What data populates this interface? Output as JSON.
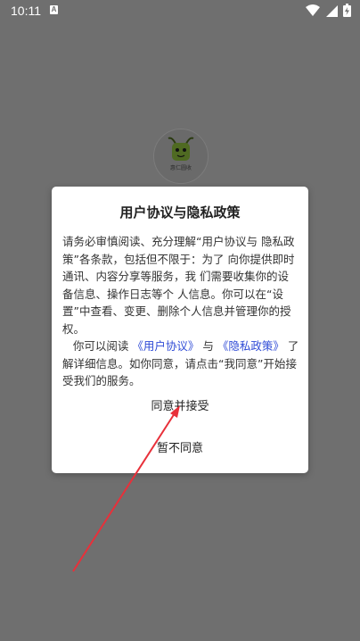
{
  "status_bar": {
    "time": "10:11",
    "notification_icon": "A"
  },
  "logo": {
    "caption": "惠仁圆收"
  },
  "dialog": {
    "title": "用户协议与隐私政策",
    "paragraph1": "请务必审慎阅读、充分理解“用户协议与 隐私政策”各条款，包括但不限于：为了 向你提供即时通讯、内容分享等服务，我 们需要收集你的设备信息、操作日志等个 人信息。你可以在“设置”中查看、变更、删除个人信息并管理你的授权。",
    "paragraph2_prefix": "你可以阅读",
    "user_agreement_link": "《用户协议》",
    "paragraph2_and": "与",
    "privacy_policy_link": "《隐私政策》",
    "paragraph2_suffix": "了解详细信息。如你同意，请点击“我同意”开始接受我们的服务。",
    "accept_label": "同意并接受",
    "decline_label": "暂不同意"
  },
  "colors": {
    "overlay": "#6f6f6f",
    "link": "#2f4bd6",
    "annotation_arrow": "#e8303a"
  }
}
